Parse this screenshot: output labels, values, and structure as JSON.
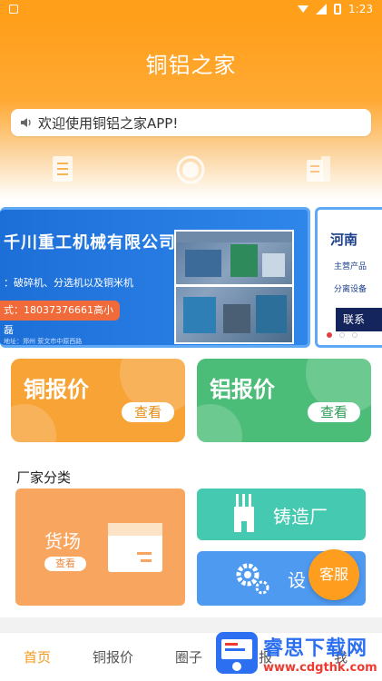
{
  "status_bar": {
    "time": "1:23"
  },
  "header": {
    "title": "铜铝之家",
    "notice": "欢迎使用铜铝之家APP!",
    "icons": [
      {
        "icon": "document-icon",
        "label": ""
      },
      {
        "icon": "circle-icon",
        "label": ""
      },
      {
        "icon": "file-icon",
        "label": ""
      }
    ]
  },
  "banner": {
    "main": {
      "company": "千川重工机械有限公司",
      "products": "：破碎机、分选机以及铜米机",
      "contact": "式：18037376661高小磊",
      "address": "地址：郑州 荥文市中原西路"
    },
    "side": {
      "title": "河南",
      "line1": "主营产品",
      "line2": "分离设备",
      "button": "联系"
    },
    "dots": 3,
    "active_dot": 1
  },
  "price_cards": [
    {
      "title": "铜报价",
      "button": "查看",
      "color": "#f7a336"
    },
    {
      "title": "铝报价",
      "button": "查看",
      "color": "#4cbd78"
    }
  ],
  "factory": {
    "title": "厂家分类",
    "yard": {
      "label": "货场",
      "button": "查看"
    },
    "foundry": {
      "label": "铸造厂"
    },
    "equipment": {
      "label": "设"
    }
  },
  "service_button": "客服",
  "bottom_nav": [
    {
      "label": "首页",
      "active": true
    },
    {
      "label": "铜报价",
      "active": false
    },
    {
      "label": "圈子",
      "active": false
    },
    {
      "label": "报",
      "active": false
    },
    {
      "label": "我",
      "active": false
    }
  ],
  "watermark": {
    "brand": "睿思下载网",
    "url": "www.cdgthk.com"
  },
  "colors": {
    "primary": "#ff9f1a",
    "copper": "#f7a336",
    "aluminum": "#4cbd78",
    "teal": "#45c9b0",
    "blue": "#4f9af1"
  }
}
